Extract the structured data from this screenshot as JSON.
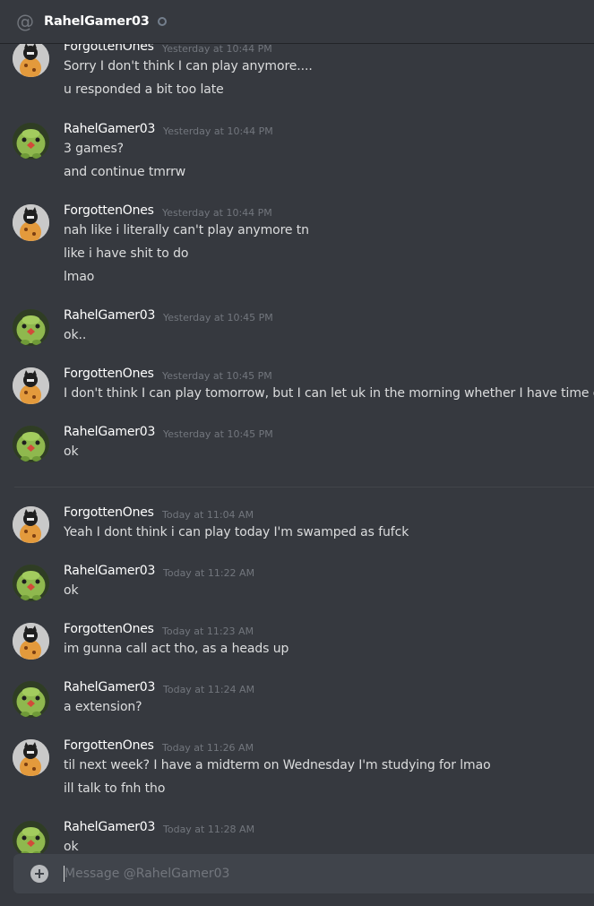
{
  "header": {
    "at_icon": "@",
    "title": "RahelGamer03",
    "status_icon": "offline-status-icon"
  },
  "messages": [
    {
      "author": "ForgottenOnes",
      "time": "Yesterday at 10:44 PM",
      "lines": [
        "Sorry I don't think I can play anymore....",
        "u responded a bit too late"
      ]
    },
    {
      "author": "RahelGamer03",
      "time": "Yesterday at 10:44 PM",
      "lines": [
        "3 games?",
        "and continue tmrrw"
      ]
    },
    {
      "author": "ForgottenOnes",
      "time": "Yesterday at 10:44 PM",
      "lines": [
        "nah like i literally can't play anymore tn",
        "like i have shit to do",
        "lmao"
      ]
    },
    {
      "author": "RahelGamer03",
      "time": "Yesterday at 10:45 PM",
      "lines": [
        "ok.."
      ]
    },
    {
      "author": "ForgottenOnes",
      "time": "Yesterday at 10:45 PM",
      "lines": [
        "I don't think I can play tomorrow, but I can let uk in the morning whether I have time or no"
      ]
    },
    {
      "author": "RahelGamer03",
      "time": "Yesterday at 10:45 PM",
      "lines": [
        "ok"
      ]
    },
    {
      "author": "ForgottenOnes",
      "time": "Today at 11:04 AM",
      "lines": [
        "Yeah I dont think i can play today I'm swamped as fufck"
      ]
    },
    {
      "author": "RahelGamer03",
      "time": "Today at 11:22 AM",
      "lines": [
        "ok"
      ]
    },
    {
      "author": "ForgottenOnes",
      "time": "Today at 11:23 AM",
      "lines": [
        "im gunna call act tho, as a heads up"
      ]
    },
    {
      "author": "RahelGamer03",
      "time": "Today at 11:24 AM",
      "lines": [
        "a extension?"
      ]
    },
    {
      "author": "ForgottenOnes",
      "time": "Today at 11:26 AM",
      "lines": [
        "til next week? I have a midterm on Wednesday I'm studying for lmao",
        "ill talk to fnh tho"
      ]
    },
    {
      "author": "RahelGamer03",
      "time": "Today at 11:28 AM",
      "lines": [
        "ok"
      ]
    }
  ],
  "composer": {
    "placeholder": "Message @RahelGamer03",
    "value": "",
    "add_icon": "plus-circle-icon"
  },
  "colors": {
    "background": "#36393f",
    "username": "#ffffff",
    "message_text": "#dcddde",
    "timestamp": "#72767d",
    "input_background": "#40444b"
  }
}
